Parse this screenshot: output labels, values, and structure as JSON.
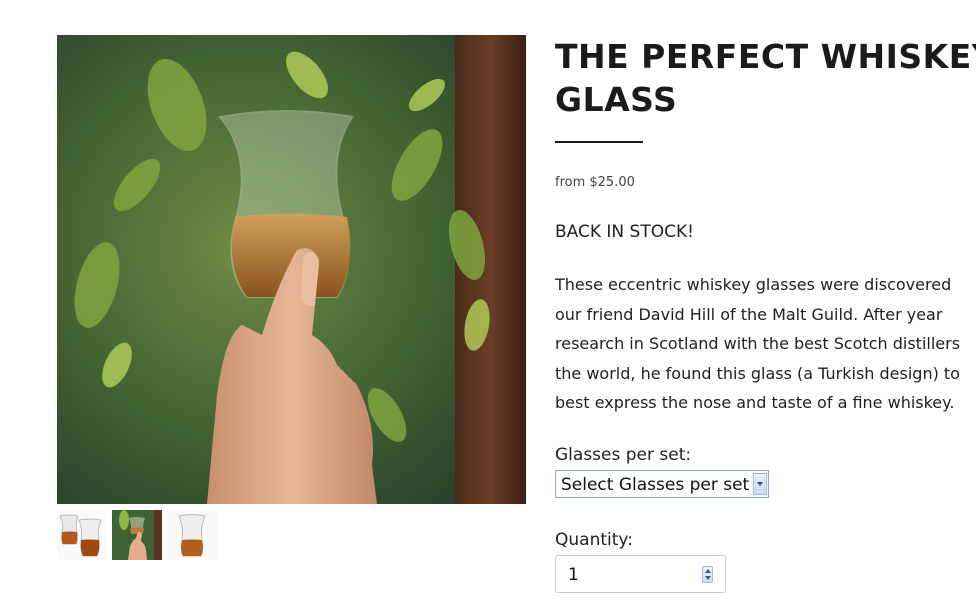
{
  "product": {
    "title_lines": [
      "THE PERFECT WHISKEY",
      "GLASS"
    ],
    "price": "from $25.00",
    "stock_notice": "BACK IN STOCK!",
    "description_lines": [
      "These eccentric whiskey glasses were discovered",
      "our friend David Hill of the Malt Guild. After year",
      "research in Scotland with the best Scotch distillers",
      "the world, he found this glass (a Turkish design) to",
      "best express the nose and taste of a fine whiskey."
    ]
  },
  "options": {
    "glasses_label": "Glasses per set:",
    "glasses_selected": "Select Glasses per set",
    "quantity_label": "Quantity:",
    "quantity_value": "1"
  },
  "gallery": {
    "thumbnail_count": 3,
    "selected_index": 1
  },
  "colors": {
    "heading": "#1b1b1b",
    "select_border": "#8ea3c7"
  }
}
